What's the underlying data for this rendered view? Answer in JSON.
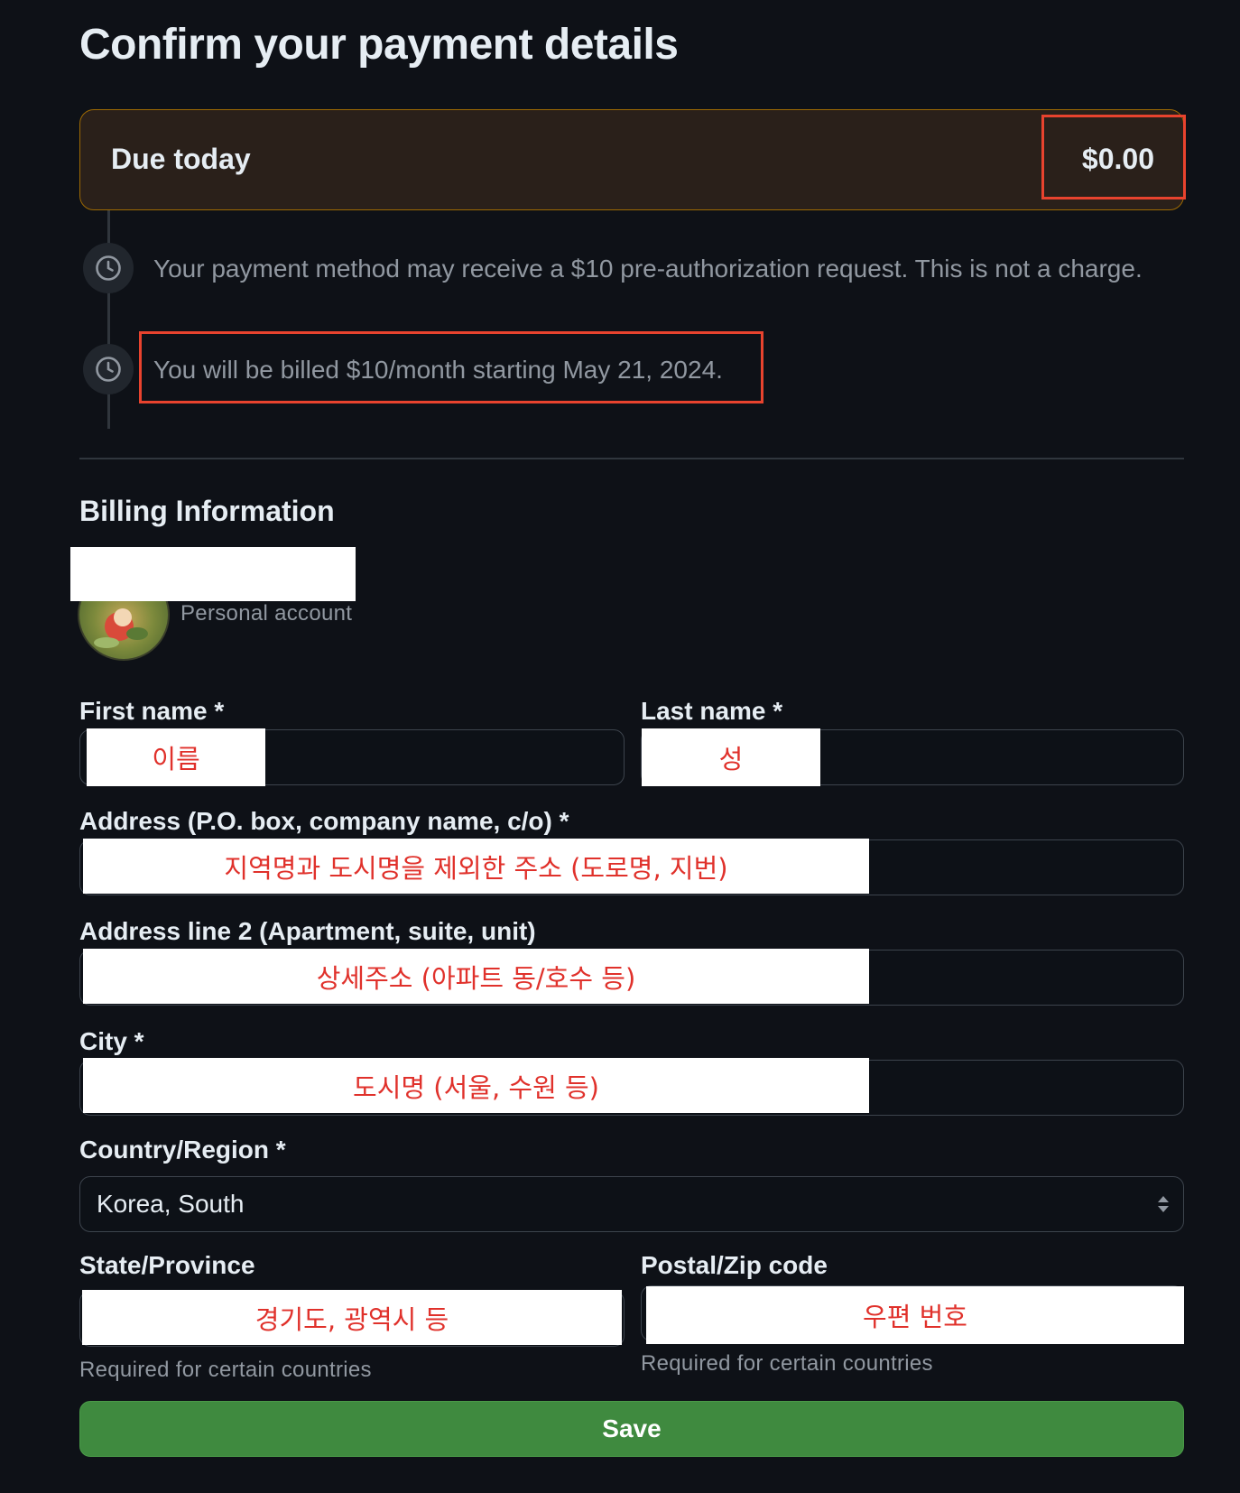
{
  "page": {
    "title": "Confirm your payment details"
  },
  "due": {
    "label": "Due today",
    "amount": "$0.00"
  },
  "timeline": [
    {
      "text": "Your payment method may receive a $10 pre-authorization request. This is not a charge.",
      "icon": "clock-icon"
    },
    {
      "text": "You will be billed $10/month starting May 21, 2024.",
      "icon": "clock-icon"
    }
  ],
  "billing": {
    "section_title": "Billing Information",
    "account_type": "Personal account"
  },
  "form": {
    "first_name": {
      "label": "First name *",
      "annotation": "이름"
    },
    "last_name": {
      "label": "Last name *",
      "annotation": "성"
    },
    "address": {
      "label": "Address (P.O. box, company name, c/o) *",
      "annotation": "지역명과 도시명을 제외한 주소 (도로명, 지번)"
    },
    "address2": {
      "label": "Address line 2 (Apartment, suite, unit)",
      "annotation": "상세주소 (아파트 동/호수 등)"
    },
    "city": {
      "label": "City *",
      "annotation": "도시명 (서울, 수원 등)"
    },
    "country": {
      "label": "Country/Region *",
      "value": "Korea, South"
    },
    "state": {
      "label": "State/Province",
      "annotation": "경기도, 광역시 등",
      "hint": "Required for certain countries"
    },
    "postal": {
      "label": "Postal/Zip code",
      "annotation": "우편 번호",
      "hint": "Required for certain countries"
    },
    "save_label": "Save"
  },
  "colors": {
    "background": "#0e1117",
    "due_box_bg": "#2a201a",
    "due_box_border": "#9e6a03",
    "highlight_red": "#e8432e",
    "save_green": "#3f8a3f"
  }
}
